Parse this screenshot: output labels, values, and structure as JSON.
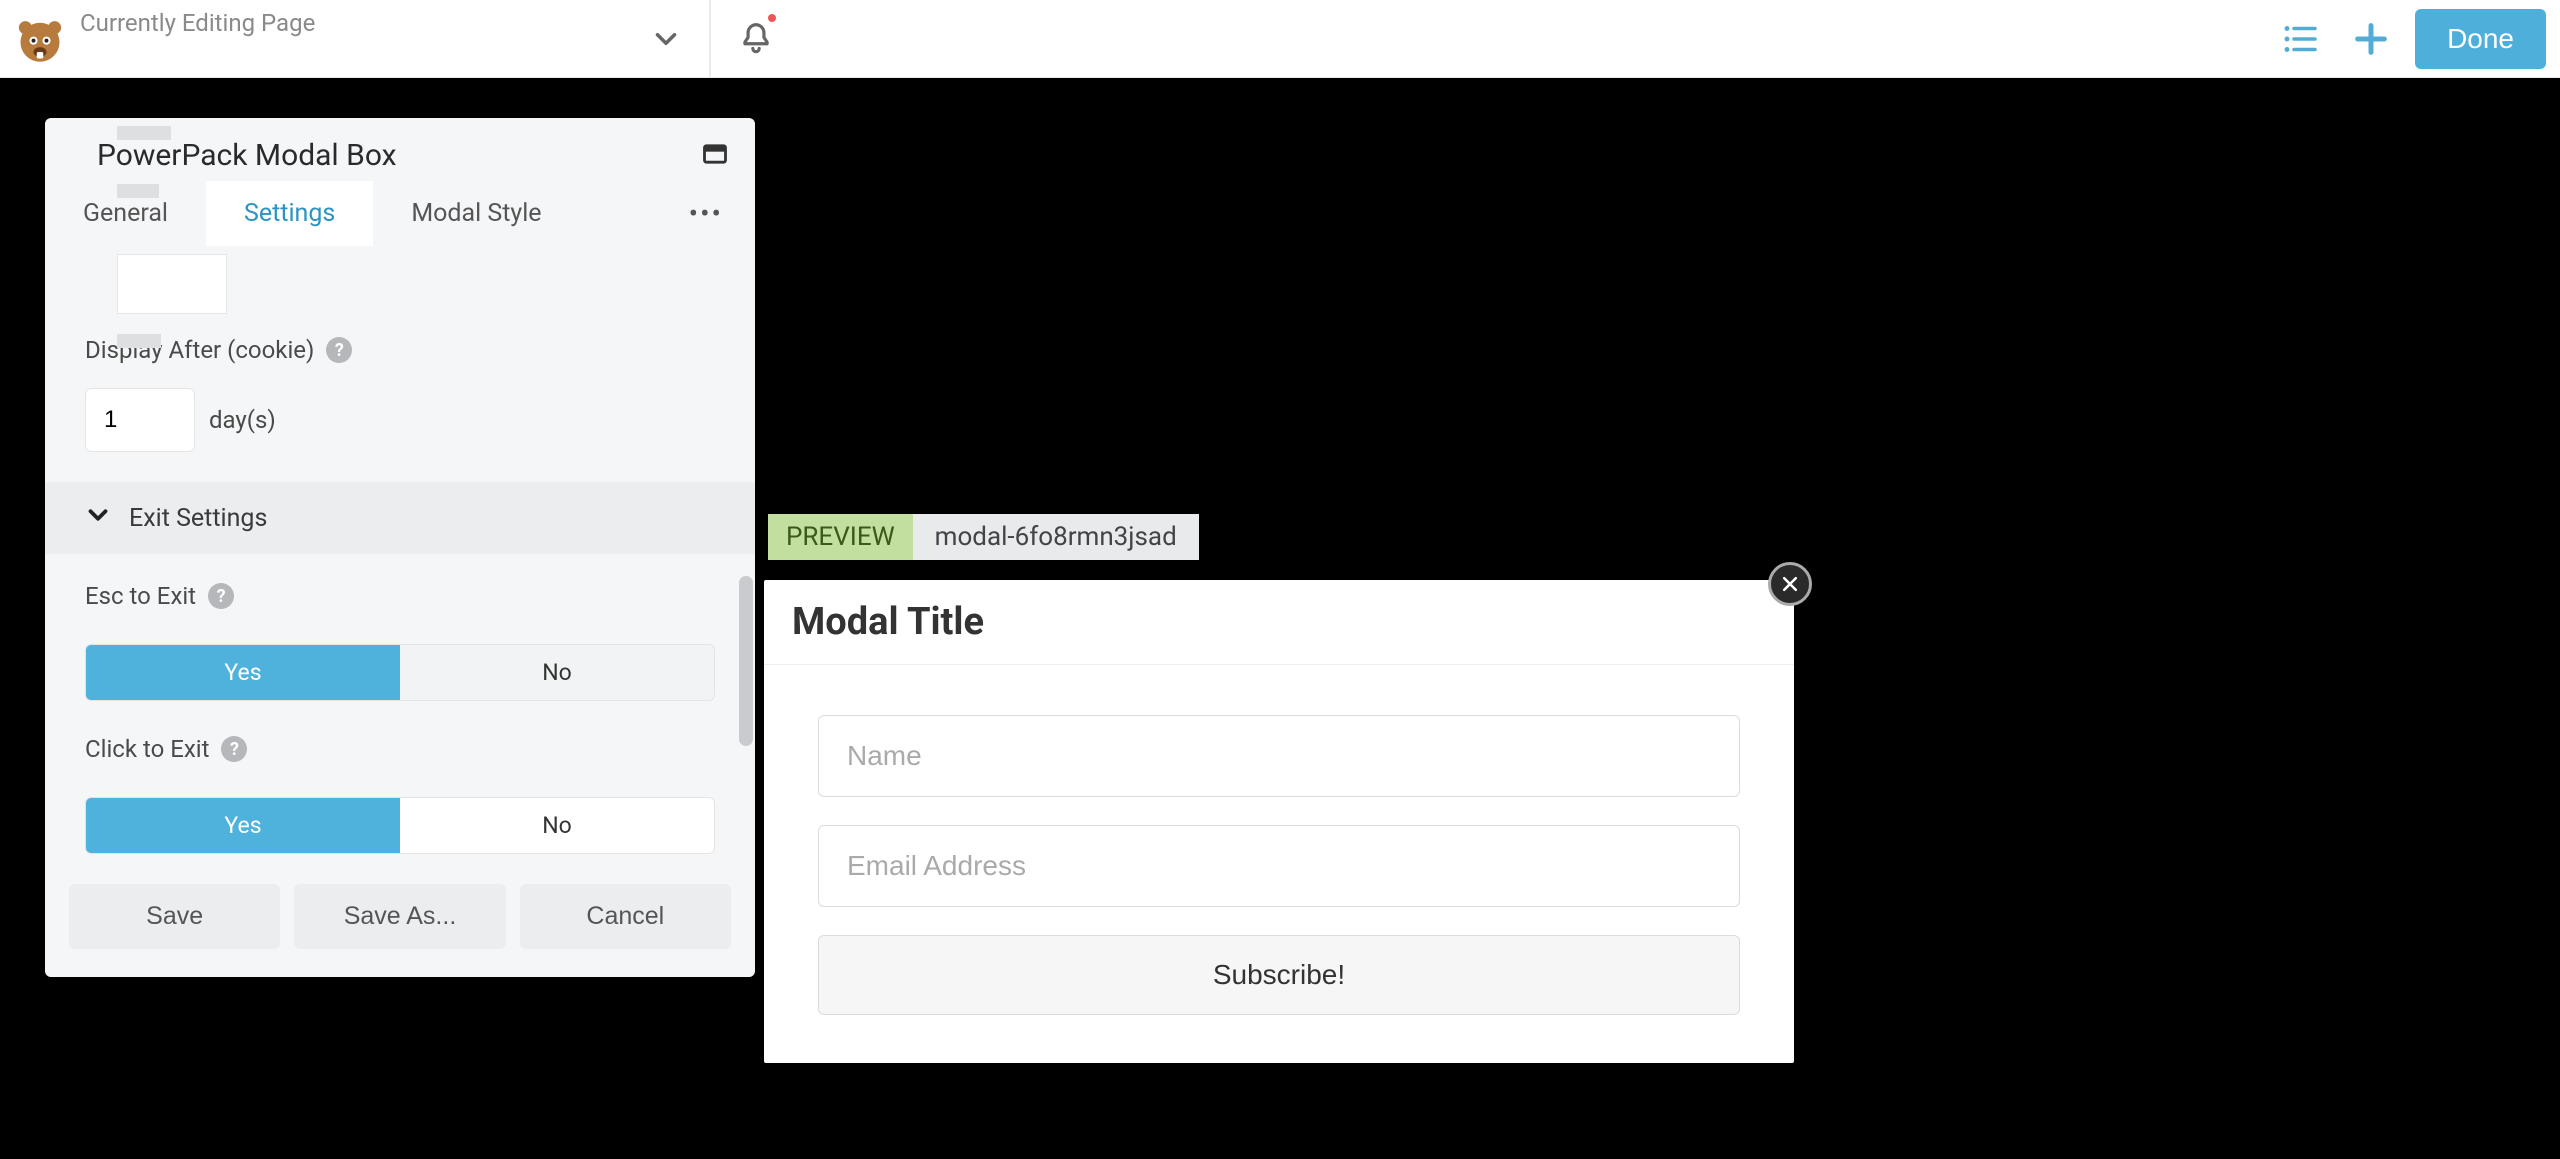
{
  "topbar": {
    "page_title": "Currently Editing Page",
    "done_label": "Done"
  },
  "panel": {
    "title": "PowerPack Modal Box",
    "tabs": {
      "general": "General",
      "settings": "Settings",
      "modal_style": "Modal Style"
    },
    "display_after": {
      "label": "Display After (cookie)",
      "value": "1",
      "unit": "day(s)"
    },
    "exit_settings_title": "Exit Settings",
    "esc_to_exit": {
      "label": "Esc to Exit",
      "yes": "Yes",
      "no": "No",
      "value": "Yes"
    },
    "click_to_exit": {
      "label": "Click to Exit",
      "yes": "Yes",
      "no": "No",
      "value": "Yes"
    },
    "actions": {
      "save": "Save",
      "save_as": "Save As...",
      "cancel": "Cancel"
    }
  },
  "preview": {
    "label": "PREVIEW",
    "id": "modal-6fo8rmn3jsad"
  },
  "modal": {
    "title": "Modal Title",
    "name_placeholder": "Name",
    "email_placeholder": "Email Address",
    "subscribe_label": "Subscribe!"
  }
}
